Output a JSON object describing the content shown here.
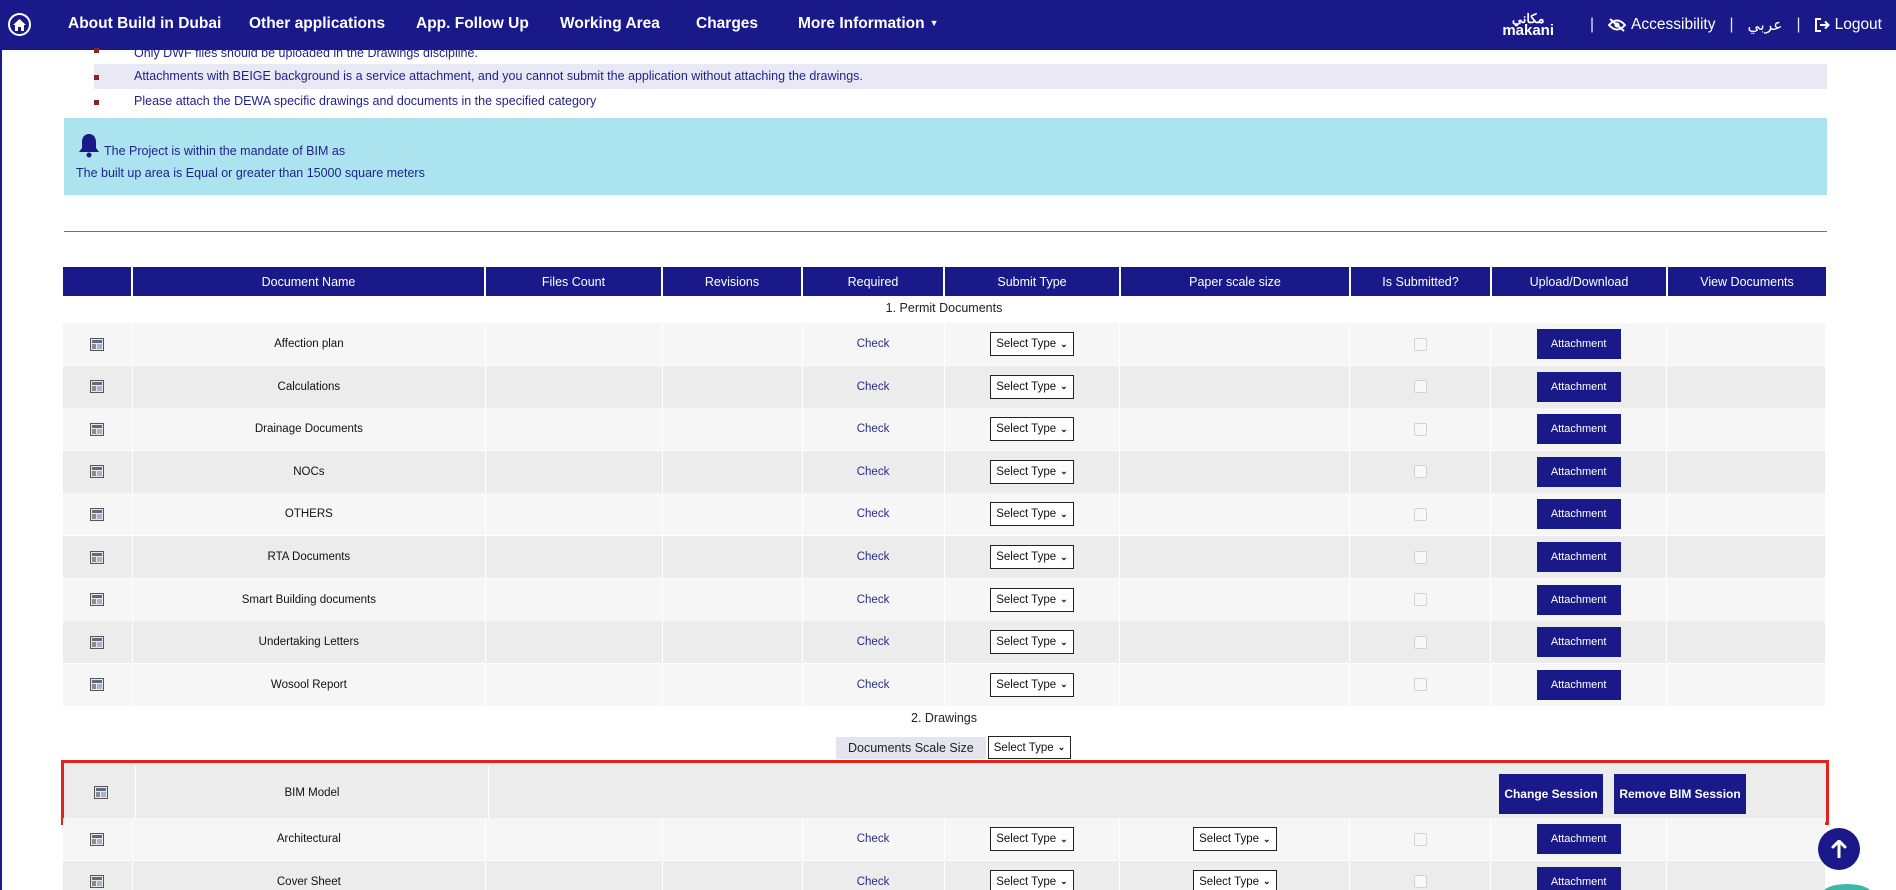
{
  "nav": {
    "items": [
      {
        "label": "About Build in Dubai"
      },
      {
        "label": "Other applications"
      },
      {
        "label": "App. Follow Up"
      },
      {
        "label": "Working Area"
      },
      {
        "label": "Charges"
      },
      {
        "label": "More Information"
      }
    ],
    "logo_ar": "مكاني",
    "logo_en": "makani",
    "accessibility": "Accessibility",
    "arabic": "عربي",
    "logout": "Logout"
  },
  "notes": [
    "Only DWF files should be uploaded in the Drawings discipline.",
    "Attachments with BEIGE background is a service attachment, and you cannot submit the application without attaching the drawings.",
    "Please attach the DEWA specific drawings and documents in the specified category"
  ],
  "alert": {
    "line1": "The Project is within the mandate of BIM as",
    "line2": "The built up area is Equal or greater than  15000 square meters"
  },
  "table": {
    "headers": [
      "",
      "Document Name",
      "Files Count",
      "Revisions",
      "Required",
      "Submit Type",
      "Paper scale size",
      "Is Submitted?",
      "Upload/Download",
      "View Documents"
    ],
    "section1": "1. Permit Documents",
    "section2": "2. Drawings",
    "check_label": "Check",
    "select_label": "Select Type",
    "attach_label": "Attachment",
    "permit_rows": [
      {
        "name": "Affection plan"
      },
      {
        "name": "Calculations"
      },
      {
        "name": "Drainage Documents"
      },
      {
        "name": "NOCs"
      },
      {
        "name": "OTHERS"
      },
      {
        "name": "RTA Documents"
      },
      {
        "name": "Smart Building documents"
      },
      {
        "name": "Undertaking Letters"
      },
      {
        "name": "Wosool Report"
      }
    ],
    "scale_label": "Documents Scale Size",
    "scale_select": "Select Type",
    "bim": {
      "name": "BIM Model",
      "change": "Change Session",
      "remove": "Remove BIM Session"
    },
    "drawing_rows": [
      {
        "name": "Architectural"
      },
      {
        "name": "Cover Sheet"
      }
    ]
  },
  "colors": {
    "primary": "#19198a",
    "alert_bg": "#abe4ee",
    "highlight_border": "#e2231a"
  }
}
